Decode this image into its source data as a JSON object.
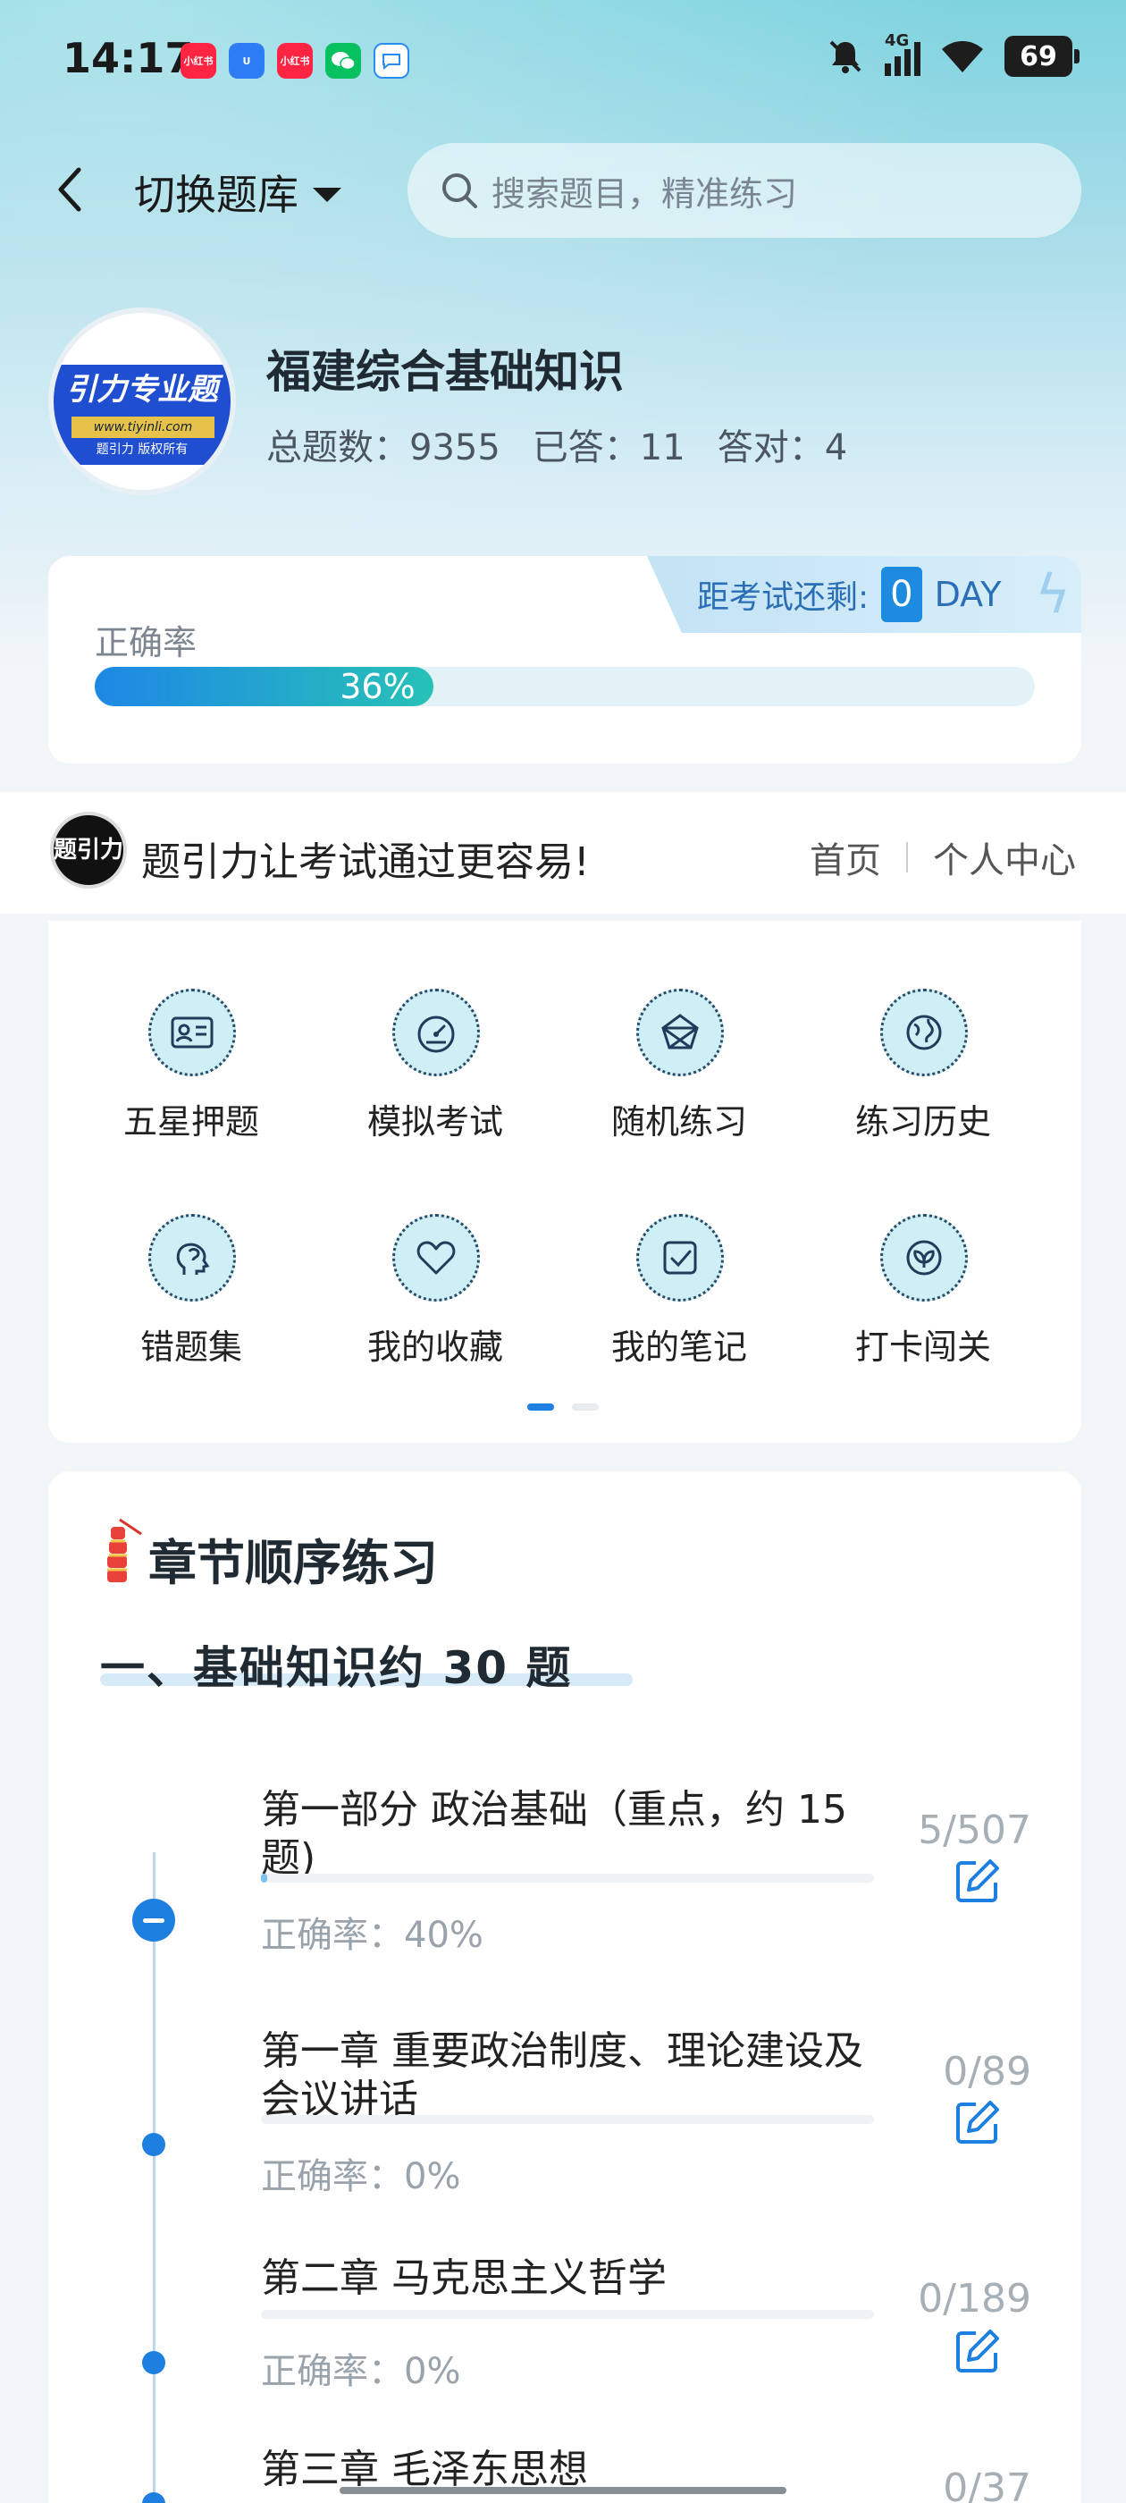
{
  "status_bar": {
    "time": "14:17",
    "apps": [
      {
        "name": "xiaohongshu-icon",
        "label": "小红书",
        "color": "#ff2442"
      },
      {
        "name": "u-app-icon",
        "label": "U",
        "color": "#2d7cf6"
      },
      {
        "name": "xiaohongshu-icon-2",
        "label": "小红书",
        "color": "#ff2442"
      },
      {
        "name": "wechat-icon",
        "label": "",
        "color": "#07c160"
      },
      {
        "name": "message-icon",
        "label": "",
        "color": "#ffffff"
      }
    ],
    "network": "4G",
    "battery": "69"
  },
  "header": {
    "switch_label": "切换题库",
    "search_placeholder": "搜索题目，精准练习"
  },
  "bank": {
    "logo_title": "引力专业题",
    "logo_url": "www.tiyinli.com",
    "logo_copyright": "题引力 版权所有",
    "title": "福建综合基础知识",
    "total_label": "总题数：9355",
    "answered_label": "已答：11",
    "correct_label": "答对：4"
  },
  "accuracy": {
    "label": "正确率",
    "value_text": "36%",
    "value": 36,
    "countdown_label": "距考试还剩:",
    "countdown_value": "0",
    "countdown_unit": "DAY"
  },
  "banner": {
    "logo_text": "题引力",
    "slogan": "题引力让考试通过更容易!",
    "nav_home": "首页",
    "nav_profile": "个人中心"
  },
  "grid": [
    {
      "label": "五星押题",
      "icon": "id-card-icon"
    },
    {
      "label": "模拟考试",
      "icon": "gauge-icon"
    },
    {
      "label": "随机练习",
      "icon": "shuffle-icon"
    },
    {
      "label": "练习历史",
      "icon": "globe-icon"
    },
    {
      "label": "错题集",
      "icon": "head-icon"
    },
    {
      "label": "我的收藏",
      "icon": "heart-icon"
    },
    {
      "label": "我的笔记",
      "icon": "note-check-icon"
    },
    {
      "label": "打卡闯关",
      "icon": "leaf-icon"
    }
  ],
  "chapter": {
    "title": "章节顺序练习",
    "section_title": "一、基础知识约 30 题",
    "items": [
      {
        "title": "第一部分 政治基础（重点，约 15 题)",
        "accuracy": "正确率：40%",
        "count": "5/507",
        "progress": 0.01
      },
      {
        "title": "第一章 重要政治制度、理论建设及会议讲话",
        "accuracy": "正确率：0%",
        "count": "0/89",
        "progress": 0
      },
      {
        "title": "第二章 马克思主义哲学",
        "accuracy": "正确率：0%",
        "count": "0/189",
        "progress": 0
      },
      {
        "title": "第三章 毛泽东思想",
        "accuracy": "",
        "count": "0/37",
        "progress": 0
      }
    ]
  },
  "colors": {
    "accent": "#1d7fe0",
    "teal": "#27c1b7"
  }
}
